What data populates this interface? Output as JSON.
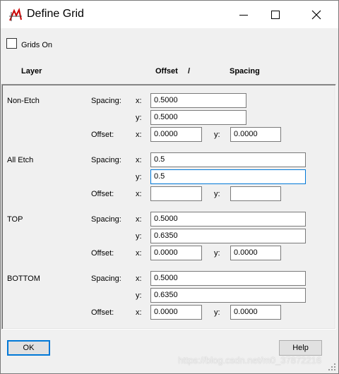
{
  "window": {
    "title": "Define Grid"
  },
  "grids_on": {
    "label": "Grids On",
    "checked": false
  },
  "headers": {
    "layer": "Layer",
    "offset": "Offset",
    "slash": "/",
    "spacing": "Spacing"
  },
  "labels": {
    "spacing": "Spacing:",
    "offset": "Offset:",
    "x": "x:",
    "y": "y:"
  },
  "layers": [
    {
      "name": "Non-Etch",
      "spacing_x": "0.5000",
      "spacing_y": "0.5000",
      "offset_x": "0.0000",
      "offset_y": "0.0000"
    },
    {
      "name": "All Etch",
      "spacing_x": "0.5",
      "spacing_y": "0.5",
      "offset_x": "",
      "offset_y": ""
    },
    {
      "name": "TOP",
      "spacing_x": "0.5000",
      "spacing_y": "0.6350",
      "offset_x": "0.0000",
      "offset_y": "0.0000"
    },
    {
      "name": "BOTTOM",
      "spacing_x": "0.5000",
      "spacing_y": "0.6350",
      "offset_x": "0.0000",
      "offset_y": "0.0000"
    }
  ],
  "buttons": {
    "ok": "OK",
    "help": "Help"
  },
  "watermark": "https://blog.csdn.net/m0_37872216"
}
